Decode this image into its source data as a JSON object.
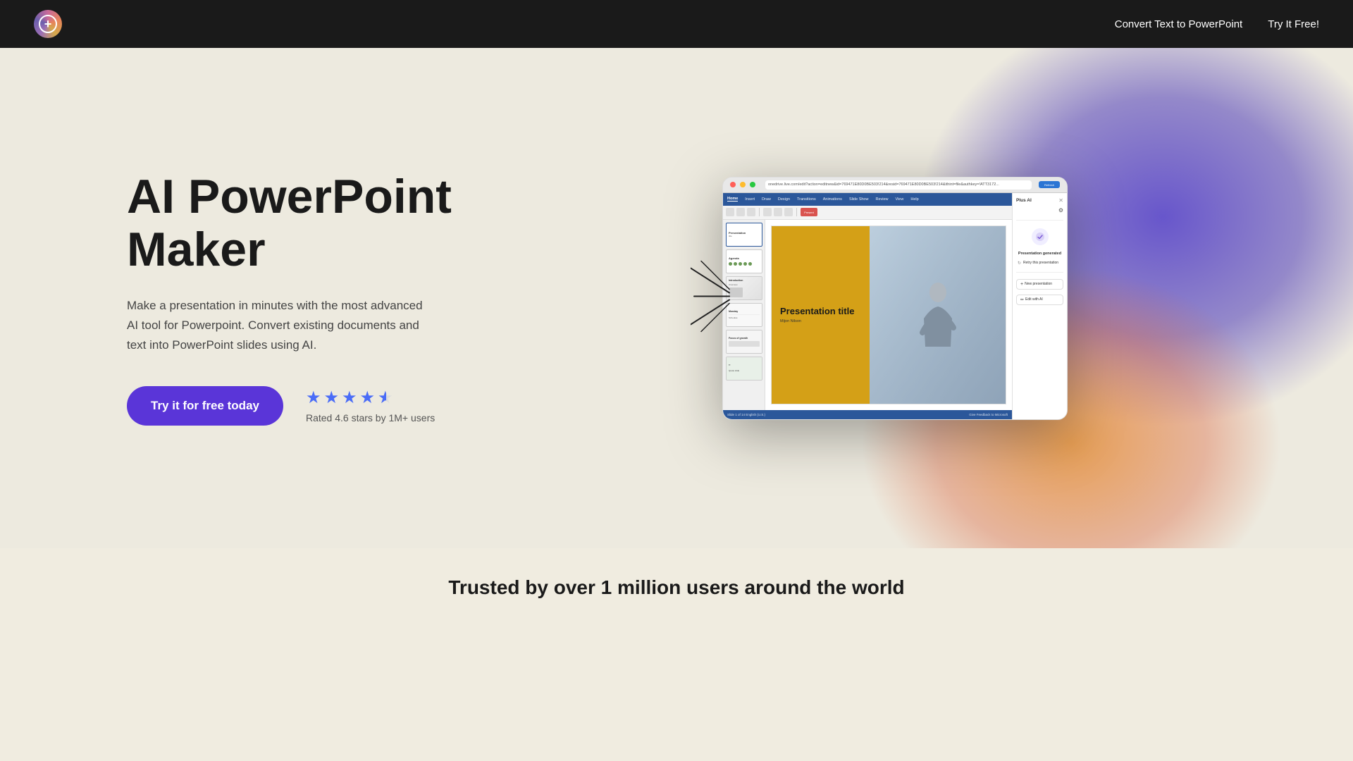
{
  "navbar": {
    "logo_symbol": "+",
    "nav_link_label": "Convert Text to PowerPoint",
    "nav_cta_label": "Try It Free!"
  },
  "hero": {
    "title_line1": "AI PowerPoint",
    "title_line2": "Maker",
    "subtitle": "Make a presentation in minutes with the most advanced AI tool for Powerpoint. Convert existing documents and text into PowerPoint slides using AI.",
    "cta_label": "Try it for free today",
    "rating_stars": "★ ★ ★ ★ ½",
    "rating_text": "Rated 4.6 stars by 1M+ users"
  },
  "mockup": {
    "url_text": "onedrive.live.com/edit?action=editnew&id=769471E80D0BE503!214&resid=769471E80D0BE503!214&ithint=file&authkey=!ATT3172...",
    "ribbon_tabs": [
      "Home",
      "Insert",
      "Draw",
      "Design",
      "Transitions",
      "Animations",
      "Slide Show",
      "Review",
      "View",
      "Help"
    ],
    "active_tab": "Home",
    "slide_title": "Presentation title",
    "slide_author": "Mijon Nilson",
    "plus_ai_title": "Plus AI",
    "presentation_generated": "Presentation generated",
    "retry_label": "Retry this presentation",
    "new_presentation_label": "New presentation",
    "edit_ai_label": "Edit with AI",
    "status_left": "Slide 1 of 14   English (U.S.)",
    "status_right": "Give Feedback to Microsoft"
  },
  "trusted": {
    "title": "Trusted by over 1 million users around the world"
  }
}
